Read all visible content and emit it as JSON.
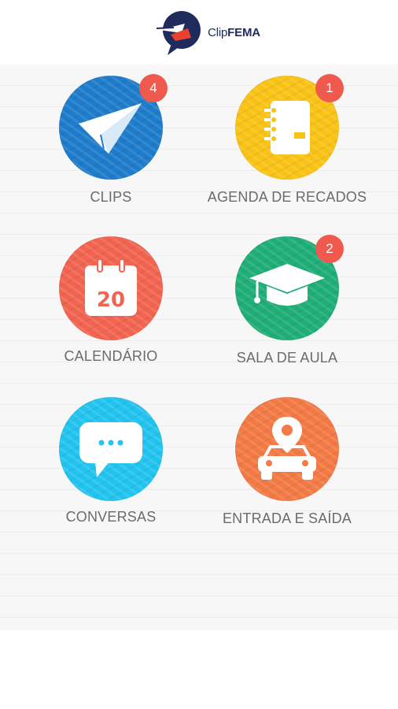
{
  "app": {
    "logo_text_clip": "Clip",
    "logo_text_fema": "FEMA"
  },
  "menu": [
    {
      "id": "clips",
      "label": "CLIPS",
      "badge": "4",
      "color": "#1e7ccb",
      "icon": "paper-plane-icon"
    },
    {
      "id": "agenda",
      "label": "AGENDA DE RECADOS",
      "badge": "1",
      "color": "#f9c316",
      "icon": "notebook-icon"
    },
    {
      "id": "calendario",
      "label": "CALENDÁRIO",
      "badge": "",
      "color": "#f26450",
      "icon": "calendar-icon",
      "icon_text": "20"
    },
    {
      "id": "sala",
      "label": "SALA DE AULA",
      "badge": "2",
      "color": "#1fae77",
      "icon": "graduation-cap-icon"
    },
    {
      "id": "conversas",
      "label": "CONVERSAS",
      "badge": "",
      "color": "#22c4ef",
      "icon": "chat-bubble-icon"
    },
    {
      "id": "entrada",
      "label": "ENTRADA E SAÍDA",
      "badge": "",
      "color": "#f37a45",
      "icon": "car-location-icon"
    }
  ]
}
